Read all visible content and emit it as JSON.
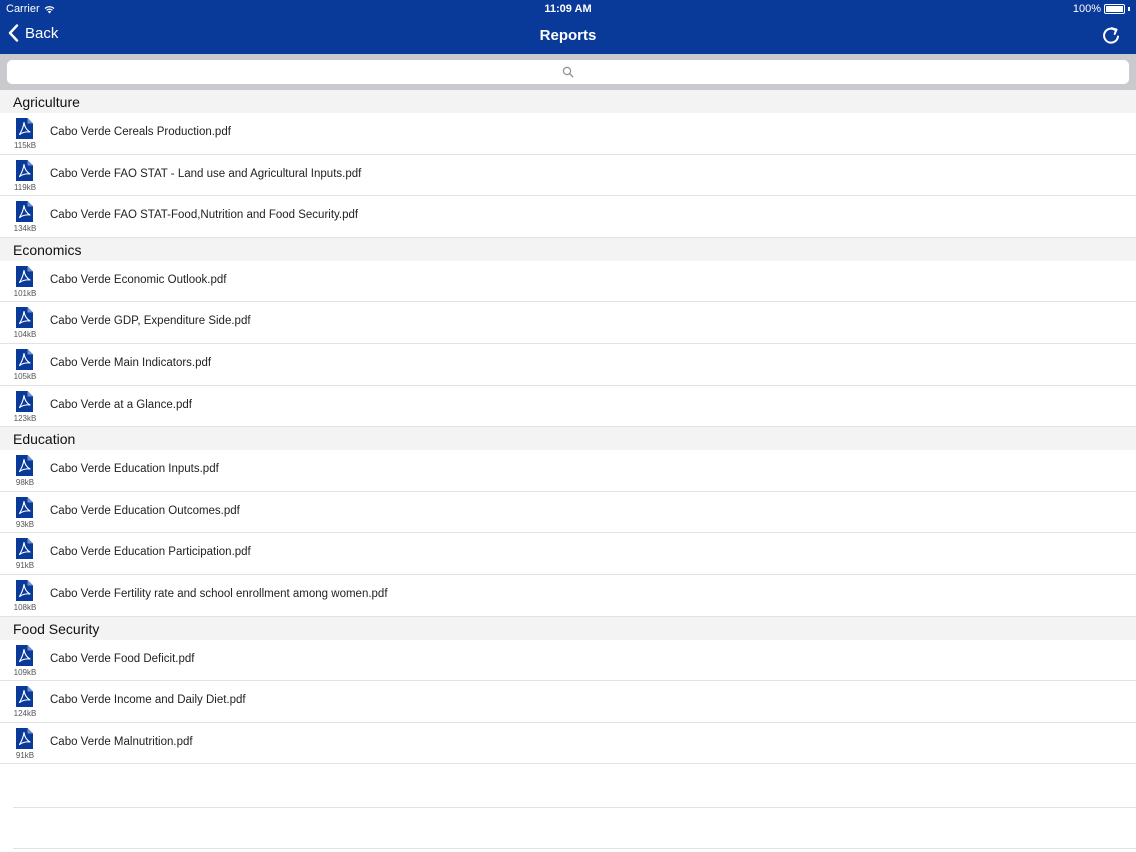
{
  "status_bar": {
    "carrier": "Carrier",
    "time": "11:09 AM",
    "battery": "100%"
  },
  "nav": {
    "back_label": "Back",
    "title": "Reports",
    "accent_color": "#0a3a99"
  },
  "search": {
    "placeholder": ""
  },
  "sections": [
    {
      "title": "Agriculture",
      "items": [
        {
          "name": "Cabo Verde Cereals Production.pdf",
          "size": "115kB"
        },
        {
          "name": "Cabo Verde FAO STAT - Land use and Agricultural Inputs.pdf",
          "size": "119kB"
        },
        {
          "name": "Cabo Verde FAO STAT-Food,Nutrition and Food Security.pdf",
          "size": "134kB"
        }
      ]
    },
    {
      "title": "Economics",
      "items": [
        {
          "name": "Cabo Verde Economic Outlook.pdf",
          "size": "101kB"
        },
        {
          "name": "Cabo Verde GDP, Expenditure Side.pdf",
          "size": "104kB"
        },
        {
          "name": "Cabo Verde Main Indicators.pdf",
          "size": "105kB"
        },
        {
          "name": "Cabo Verde at a Glance.pdf",
          "size": "123kB"
        }
      ]
    },
    {
      "title": "Education",
      "items": [
        {
          "name": "Cabo Verde Education Inputs.pdf",
          "size": "98kB"
        },
        {
          "name": "Cabo Verde Education Outcomes.pdf",
          "size": "93kB"
        },
        {
          "name": "Cabo Verde Education Participation.pdf",
          "size": "91kB"
        },
        {
          "name": "Cabo Verde Fertility rate and school enrollment among women.pdf",
          "size": "108kB"
        }
      ]
    },
    {
      "title": "Food Security",
      "items": [
        {
          "name": "Cabo Verde Food Deficit.pdf",
          "size": "109kB"
        },
        {
          "name": "Cabo Verde Income and Daily Diet.pdf",
          "size": "124kB"
        },
        {
          "name": "Cabo Verde Malnutrition.pdf",
          "size": "91kB"
        }
      ]
    }
  ]
}
